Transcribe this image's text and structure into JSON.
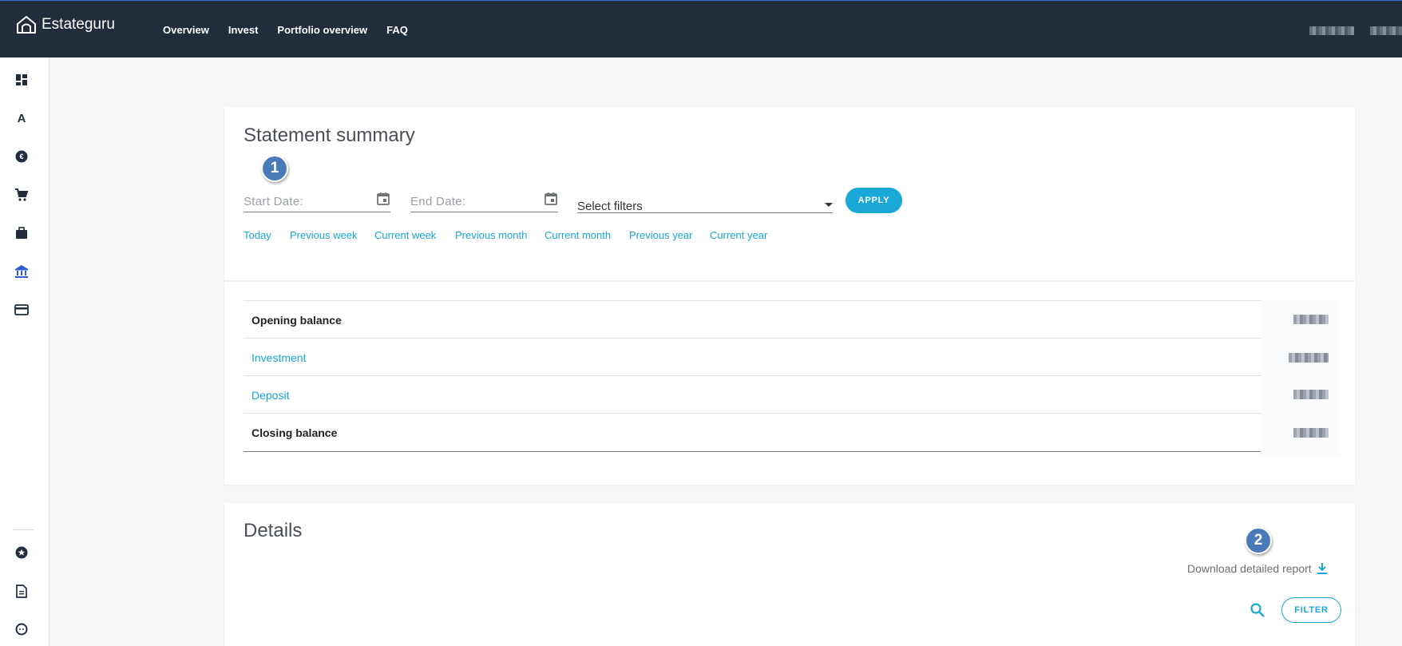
{
  "header": {
    "brand": "Estateguru",
    "nav": [
      {
        "label": "Overview"
      },
      {
        "label": "Invest"
      },
      {
        "label": "Portfolio overview"
      },
      {
        "label": "FAQ"
      }
    ]
  },
  "sidebar": {
    "items": [
      {
        "icon": "dashboard-icon"
      },
      {
        "icon": "letter-a-icon",
        "text": "A"
      },
      {
        "icon": "euro-coin-icon",
        "text": "€"
      },
      {
        "icon": "cart-icon"
      },
      {
        "icon": "briefcase-icon"
      },
      {
        "icon": "bank-icon",
        "active": true
      },
      {
        "icon": "credit-card-icon"
      }
    ],
    "bottom_items": [
      {
        "icon": "star-badge-icon"
      },
      {
        "icon": "document-icon"
      },
      {
        "icon": "support-agent-icon"
      }
    ]
  },
  "summary": {
    "title": "Statement summary",
    "badge": "1",
    "start_date_placeholder": "Start Date:",
    "end_date_placeholder": "End Date:",
    "filter_select": "Select filters",
    "apply_label": "APPLY",
    "quick_ranges": [
      "Today",
      "Previous week",
      "Current week",
      "Previous month",
      "Current month",
      "Previous year",
      "Current year"
    ]
  },
  "balances": {
    "rows": [
      {
        "label": "Opening balance"
      },
      {
        "label": "Investment"
      },
      {
        "label": "Deposit"
      },
      {
        "label": "Closing balance"
      }
    ]
  },
  "details": {
    "title": "Details",
    "badge": "2",
    "download_label": "Download detailed report",
    "filter_label": "FILTER"
  },
  "colors": {
    "topbar": "#212d3d",
    "accent": "#1aa8d9",
    "badge": "#4a7bb9",
    "active_nav": "#2f5bd0"
  }
}
